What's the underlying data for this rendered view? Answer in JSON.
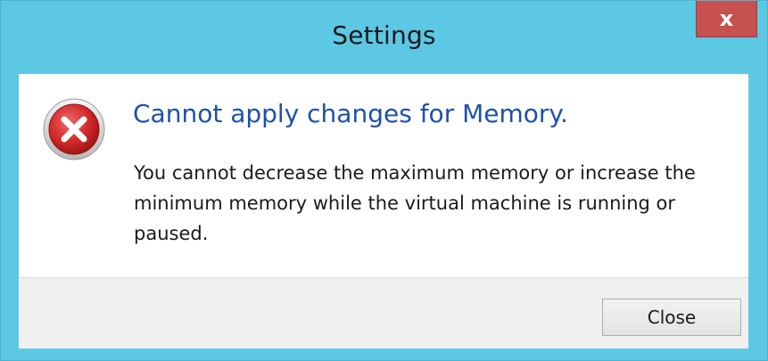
{
  "window": {
    "title": "Settings",
    "close_glyph": "x",
    "titlebar_color": "#5dc8e4",
    "close_color": "#c75050"
  },
  "dialog": {
    "icon": "error-icon",
    "heading": "Cannot apply changes for Memory.",
    "message": "You cannot decrease the maximum memory or increase the minimum memory while the virtual machine is running or paused.",
    "heading_color": "#1e51a8"
  },
  "footer": {
    "close_label": "Close"
  }
}
